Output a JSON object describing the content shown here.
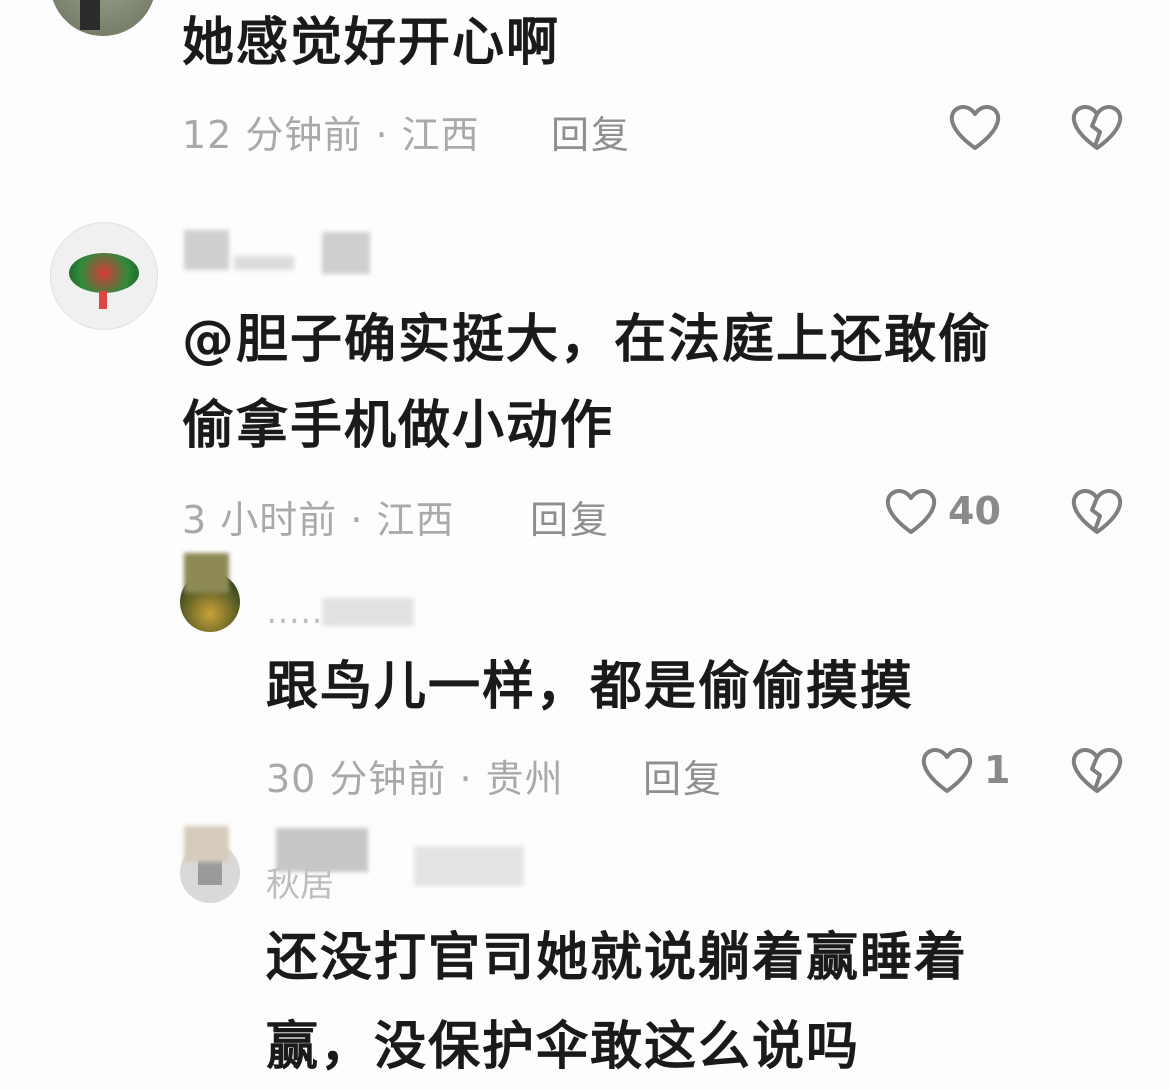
{
  "comments": [
    {
      "text": "她感觉好开心啊",
      "meta": "12 分钟前 · 江西",
      "reply_label": "回复",
      "likes": ""
    },
    {
      "text_lines": [
        "@胆子确实挺大，在法庭上还敢偷",
        "偷拿手机做小动作"
      ],
      "meta": "3 小时前 · 江西",
      "reply_label": "回复",
      "likes": "40"
    },
    {
      "name": "……",
      "text": "跟鸟儿一样，都是偷偷摸摸",
      "meta": "30 分钟前 · 贵州",
      "reply_label": "回复",
      "likes": "1"
    },
    {
      "name": "秋居",
      "text_lines": [
        "还没打官司她就说躺着赢睡着",
        "赢，没保护伞敢这么说吗"
      ]
    }
  ],
  "icons": {
    "like": "heart-outline-icon",
    "dislike": "broken-heart-icon"
  },
  "colors": {
    "text": "#1a1a1a",
    "meta": "#a9a9a9",
    "reply": "#8f8f8f",
    "icon": "#7f7f7f"
  }
}
